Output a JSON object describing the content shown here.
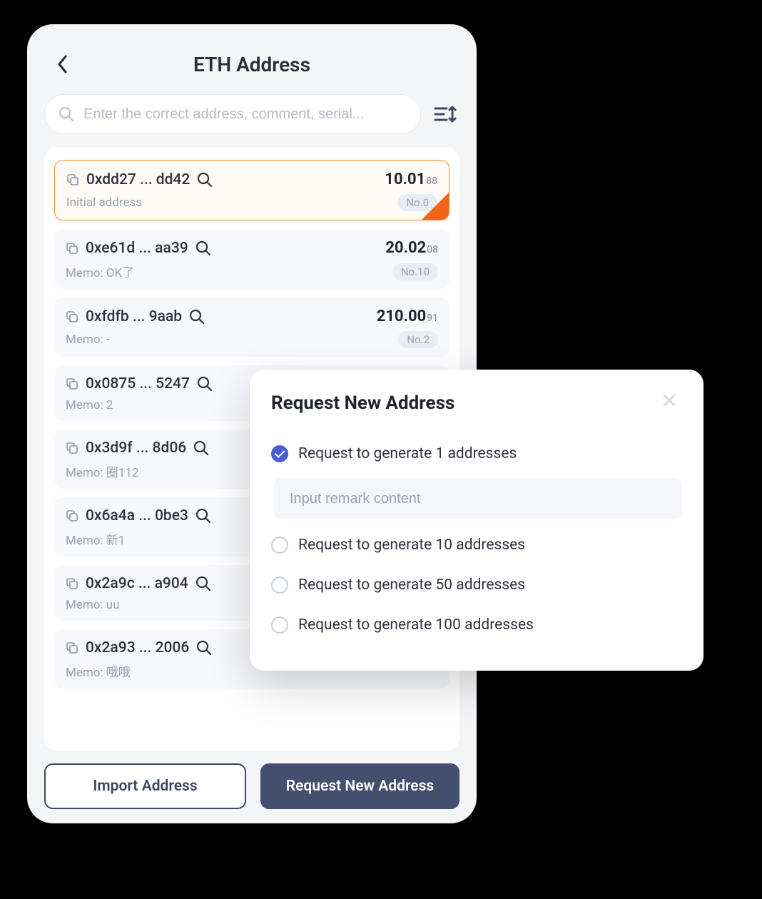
{
  "header": {
    "title": "ETH Address"
  },
  "search": {
    "placeholder": "Enter the correct address, comment, serial..."
  },
  "addresses": [
    {
      "addr": "0xdd27 ... dd42",
      "balance_main": "10.01",
      "balance_sub": "88",
      "memo": "Initial address",
      "no": "No.0",
      "selected": true
    },
    {
      "addr": "0xe61d ... aa39",
      "balance_main": "20.02",
      "balance_sub": "08",
      "memo": "Memo: OK了",
      "no": "No.10",
      "selected": false
    },
    {
      "addr": "0xfdfb ... 9aab",
      "balance_main": "210.00",
      "balance_sub": "91",
      "memo": "Memo: -",
      "no": "No.2",
      "selected": false
    },
    {
      "addr": "0x0875 ... 5247",
      "balance_main": "",
      "balance_sub": "",
      "memo": "Memo: 2",
      "no": "",
      "selected": false
    },
    {
      "addr": "0x3d9f ... 8d06",
      "balance_main": "",
      "balance_sub": "",
      "memo": "Memo: 圈112",
      "no": "",
      "selected": false
    },
    {
      "addr": "0x6a4a ... 0be3",
      "balance_main": "",
      "balance_sub": "",
      "memo": "Memo: 新1",
      "no": "",
      "selected": false
    },
    {
      "addr": "0x2a9c ... a904",
      "balance_main": "",
      "balance_sub": "",
      "memo": "Memo: uu",
      "no": "",
      "selected": false
    },
    {
      "addr": "0x2a93 ... 2006",
      "balance_main": "",
      "balance_sub": "",
      "memo": "Memo: 哦哦",
      "no": "",
      "selected": false
    }
  ],
  "footer": {
    "import_label": "Import Address",
    "request_label": "Request New Address"
  },
  "modal": {
    "title": "Request New Address",
    "remark_placeholder": "Input remark content",
    "options": [
      {
        "label": "Request to generate 1 addresses",
        "checked": true
      },
      {
        "label": "Request to generate 10 addresses",
        "checked": false
      },
      {
        "label": "Request to generate 50 addresses",
        "checked": false
      },
      {
        "label": "Request to generate 100 addresses",
        "checked": false
      }
    ]
  }
}
